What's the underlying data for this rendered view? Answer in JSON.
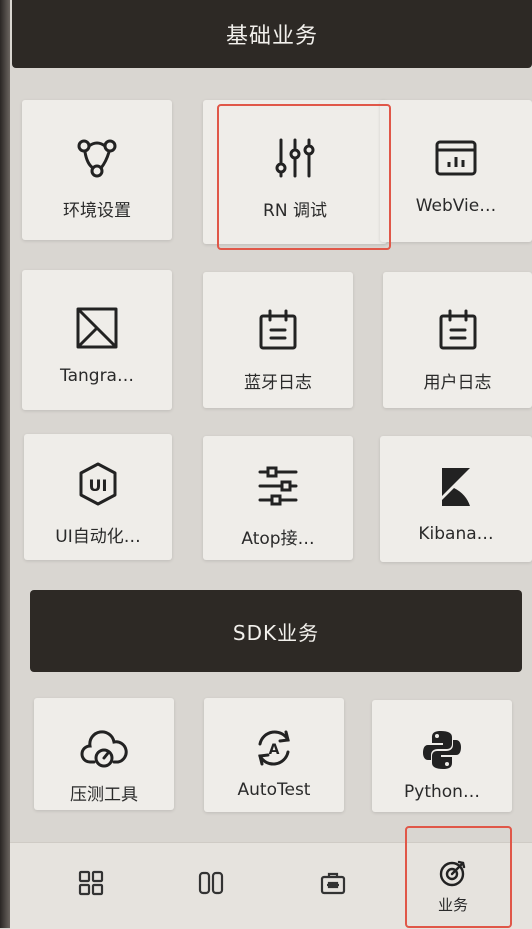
{
  "header": {
    "title": "基础业务"
  },
  "grid_top": [
    {
      "label": "环境设置",
      "icon": "network-nodes-icon"
    },
    {
      "label": "RN 调试",
      "icon": "sliders-vertical-icon"
    },
    {
      "label": "WebVie…",
      "icon": "browser-chart-icon"
    },
    {
      "label": "Tangra…",
      "icon": "diagonal-square-icon"
    },
    {
      "label": "蓝牙日志",
      "icon": "calendar-log-icon"
    },
    {
      "label": "用户日志",
      "icon": "calendar-log-icon"
    },
    {
      "label": "UI自动化…",
      "icon": "ui-badge-icon"
    },
    {
      "label": "Atop接…",
      "icon": "sliders-horizontal-icon"
    },
    {
      "label": "Kibana…",
      "icon": "kibana-logo-icon"
    }
  ],
  "sdk_section": {
    "title": "SDK业务"
  },
  "grid_sdk": [
    {
      "label": "压测工具",
      "icon": "cloud-gauge-icon"
    },
    {
      "label": "AutoTest",
      "icon": "auto-refresh-icon"
    },
    {
      "label": "Python…",
      "icon": "python-logo-icon"
    }
  ],
  "bottom_nav": [
    {
      "label": "",
      "icon": "grid-icon"
    },
    {
      "label": "",
      "icon": "switch-icon"
    },
    {
      "label": "",
      "icon": "toolbox-icon"
    },
    {
      "label": "业务",
      "icon": "target-icon",
      "active": true
    }
  ],
  "colors": {
    "header_bg": "#2d2925",
    "tile_bg": "#efede9",
    "highlight": "#e05748"
  }
}
